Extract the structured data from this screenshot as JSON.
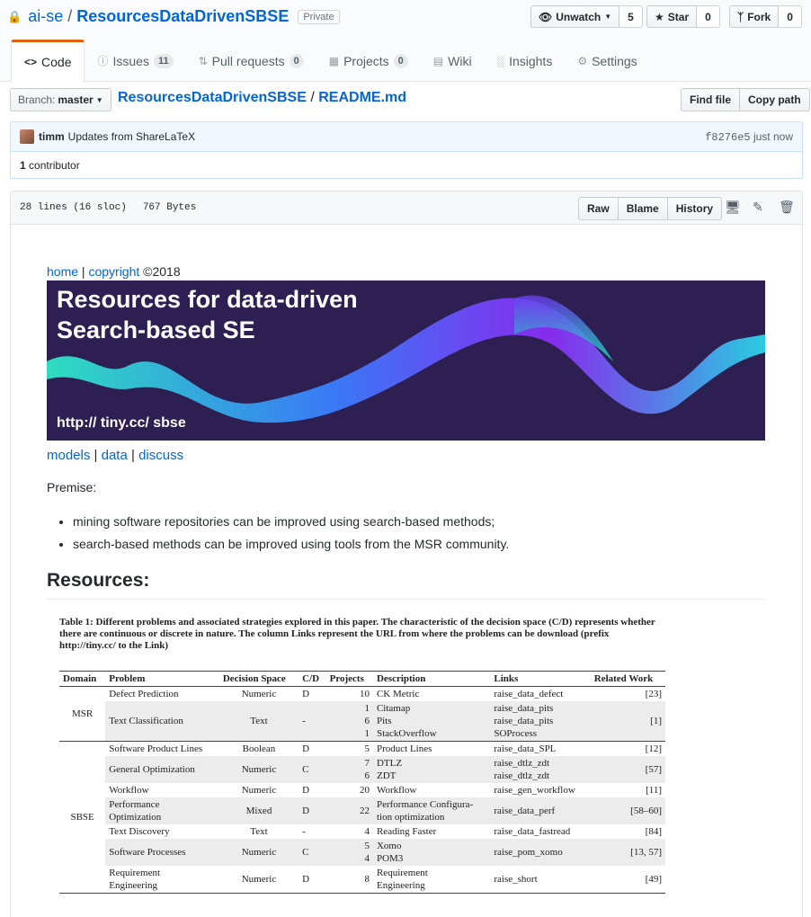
{
  "repo": {
    "owner": "ai-se",
    "name": "ResourcesDataDrivenSBSE",
    "visibility": "Private"
  },
  "actions": {
    "watch_label": "Unwatch",
    "watch_count": "5",
    "star_label": "Star",
    "star_count": "0",
    "fork_label": "Fork",
    "fork_count": "0"
  },
  "tabs": [
    {
      "label": "Code",
      "icon": "code-icon"
    },
    {
      "label": "Issues",
      "count": "11",
      "icon": "issue-icon"
    },
    {
      "label": "Pull requests",
      "count": "0",
      "icon": "pr-icon"
    },
    {
      "label": "Projects",
      "count": "0",
      "icon": "project-icon"
    },
    {
      "label": "Wiki",
      "icon": "book-icon"
    },
    {
      "label": "Insights",
      "icon": "graph-icon"
    },
    {
      "label": "Settings",
      "icon": "gear-icon"
    }
  ],
  "branch": {
    "prefix": "Branch:",
    "name": "master"
  },
  "path": {
    "repo": "ResourcesDataDrivenSBSE",
    "sep": "/",
    "file": "README.md"
  },
  "file_actions": {
    "find": "Find file",
    "copy": "Copy path"
  },
  "commit": {
    "author": "timm",
    "message": "Updates from ShareLaTeX",
    "sha": "f8276e5",
    "when": "just now"
  },
  "contributors": {
    "count": "1",
    "label": "contributor"
  },
  "file": {
    "lines": "28 lines (16 sloc)",
    "size": "767 Bytes",
    "raw": "Raw",
    "blame": "Blame",
    "history": "History"
  },
  "readme": {
    "nav": {
      "home": "home",
      "bar": "|",
      "copyright": "copyright",
      "year": "©2018"
    },
    "banner": {
      "line1": "Resources for data-driven",
      "line2": "Search-based SE",
      "url": "http:// tiny.cc/ sbse"
    },
    "links": {
      "models": "models",
      "data": "data",
      "discuss": "discuss",
      "bar": "|"
    },
    "premise_label": "Premise:",
    "bullets": [
      "mining software repositories can be improved using search-based methods;",
      "search-based methods can be improved using tools from the MSR community."
    ],
    "heading": "Resources:"
  },
  "paper_table": {
    "caption": "Table 1: Different problems and associated strategies explored in this paper. The characteristic of the decision space (C/D) represents whether there are continuous or discrete in nature. The column Links represent the URL from where the problems can be download (prefix http://tiny.cc/ to the Link)",
    "headers": [
      "Domain",
      "Problem",
      "Decision Space",
      "C/D",
      "Projects",
      "Description",
      "Links",
      "Related Work"
    ],
    "domains": [
      "MSR",
      "SBSE"
    ],
    "rows": [
      {
        "problem": "Defect Prediction",
        "space": "Numeric",
        "cd": "D",
        "projects": "10",
        "desc": "CK Metric",
        "links": "raise_data_defect",
        "related": "[23]"
      },
      {
        "problem": "Text Classification",
        "space": "Text",
        "cd": "-",
        "projects": "1\n6\n1",
        "desc": "Citamap\nPits\nStackOverflow",
        "links": "raise_data_pits\nraise_data_pits\nSOProcess",
        "related": "[1]"
      },
      {
        "problem": "Software Product Lines",
        "space": "Boolean",
        "cd": "D",
        "projects": "5",
        "desc": "Product Lines",
        "links": "raise_data_SPL",
        "related": "[12]"
      },
      {
        "problem": "General Optimization",
        "space": "Numeric",
        "cd": "C",
        "projects": "7\n6",
        "desc": "DTLZ\nZDT",
        "links": "raise_dtlz_zdt\nraise_dtlz_zdt",
        "related": "[57]"
      },
      {
        "problem": "Workflow",
        "space": "Numeric",
        "cd": "D",
        "projects": "20",
        "desc": "Workflow",
        "links": "raise_gen_workflow",
        "related": "[11]"
      },
      {
        "problem": "Performance\nOptimization",
        "space": "Mixed",
        "cd": "D",
        "projects": "22",
        "desc": "Performance Configura-\ntion optimization",
        "links": "raise_data_perf",
        "related": "[58–60]"
      },
      {
        "problem": "Text Discovery",
        "space": "Text",
        "cd": "-",
        "projects": "4",
        "desc": "Reading Faster",
        "links": "raise_data_fastread",
        "related": "[84]"
      },
      {
        "problem": "Software Processes",
        "space": "Numeric",
        "cd": "C",
        "projects": "5\n4",
        "desc": "Xomo\nPOM3",
        "links": "raise_pom_xomo",
        "related": "[13, 57]"
      },
      {
        "problem": "Requirement\nEngineering",
        "space": "Numeric",
        "cd": "D",
        "projects": "8",
        "desc": "Requirement\nEngineering",
        "links": "raise_short",
        "related": "[49]"
      }
    ]
  },
  "colors": {
    "link": "#0366d6",
    "accent_tab": "#e36209",
    "banner_bg": "#2d1f52",
    "commit_bg": "#f1f8ff"
  }
}
